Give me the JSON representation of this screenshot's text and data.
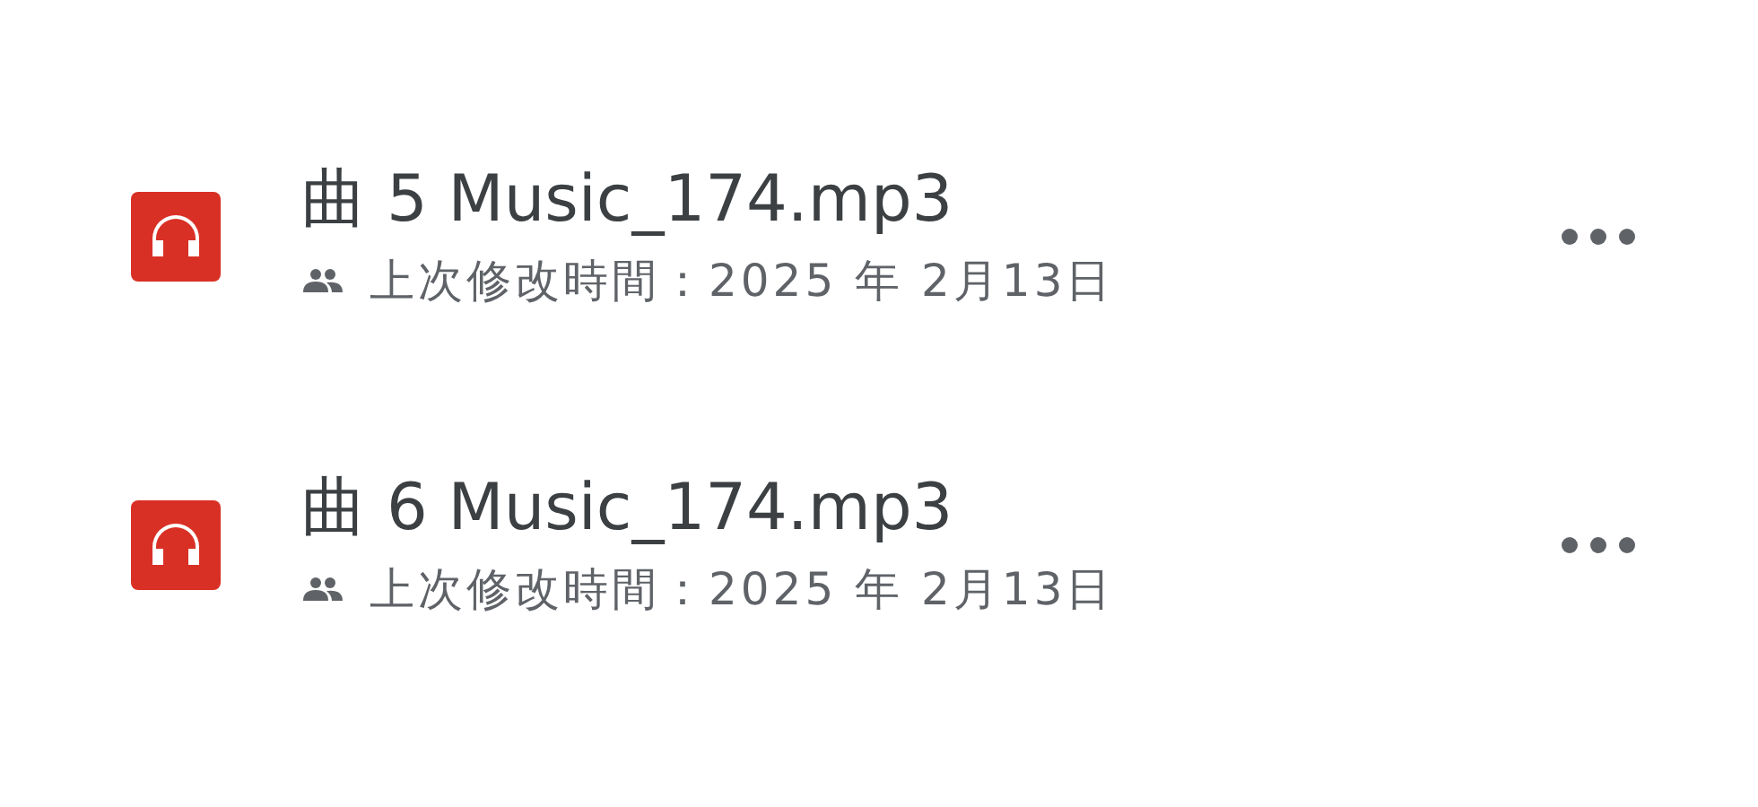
{
  "files": [
    {
      "name": "曲 5 Music_174.mp3",
      "shared": true,
      "modified": "上次修改時間：2025 年 2月13日"
    },
    {
      "name": "曲 6 Music_174.mp3",
      "shared": true,
      "modified": "上次修改時間：2025 年 2月13日"
    }
  ]
}
